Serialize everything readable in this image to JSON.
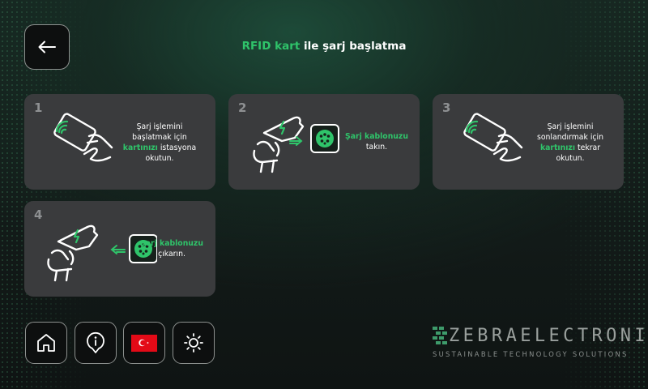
{
  "header": {
    "title_accent": "RFID kart",
    "title_rest": " ile şarj başlatma"
  },
  "steps": [
    {
      "number": "1",
      "line1": "Şarj işlemini",
      "line2": "başlatmak için",
      "highlight": "kartınızı",
      "after": " istasyona",
      "line4": "okutun."
    },
    {
      "number": "2",
      "highlight": "Şarj kablonuzu",
      "after": "takın."
    },
    {
      "number": "3",
      "line1": "Şarj işlemini",
      "line2": "sonlandırmak için",
      "highlight": "kartınızı",
      "after": " tekrar",
      "line4": "okutun."
    },
    {
      "number": "4",
      "highlight": "Şarj kablonuzu",
      "after": "çıkarın."
    }
  ],
  "bottom_nav": [
    "home-icon",
    "info-icon",
    "turkish-flag-icon",
    "brightness-icon"
  ],
  "logo": {
    "name_part1": "ZEBRA",
    "name_part2": "ELECTRONICS",
    "tagline": "SUSTAINABLE TECHNOLOGY SOLUTIONS"
  },
  "colors": {
    "accent": "#2fc46a",
    "card_bg": "#3a3b3d",
    "flag_red": "#e30a17"
  }
}
